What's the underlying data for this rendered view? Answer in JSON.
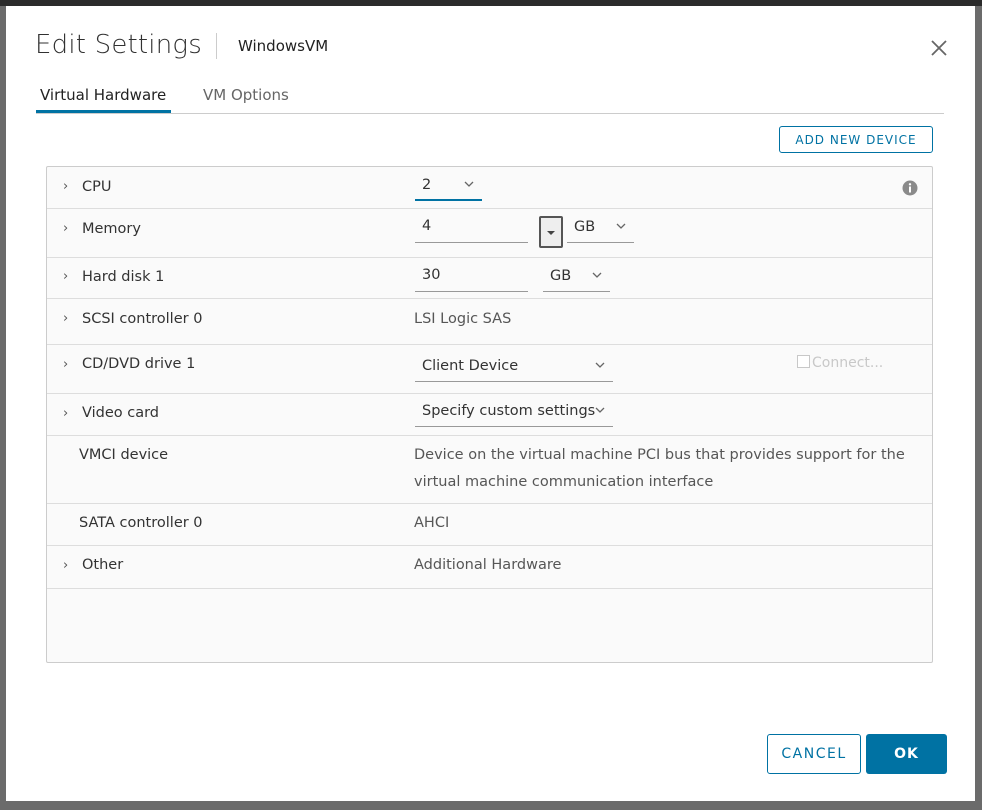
{
  "dialog": {
    "title": "Edit Settings",
    "vm_name": "WindowsVM"
  },
  "tabs": [
    {
      "label": "Virtual Hardware",
      "active": true
    },
    {
      "label": "VM Options",
      "active": false
    }
  ],
  "toolbar": {
    "add_device_label": "ADD NEW DEVICE"
  },
  "hardware": {
    "cpu": {
      "label": "CPU",
      "value": "2"
    },
    "memory": {
      "label": "Memory",
      "value": "4",
      "unit": "GB"
    },
    "hard_disk": {
      "label": "Hard disk 1",
      "value": "30",
      "unit": "GB"
    },
    "scsi": {
      "label": "SCSI controller 0",
      "value": "LSI Logic SAS"
    },
    "cd_dvd": {
      "label": "CD/DVD drive 1",
      "value": "Client Device",
      "connect_label": "Connect..."
    },
    "video": {
      "label": "Video card",
      "value": "Specify custom settings"
    },
    "vmci": {
      "label": "VMCI device",
      "desc_line1": "Device on the virtual machine PCI bus that provides support for the",
      "desc_line2": "virtual machine communication interface"
    },
    "sata": {
      "label": "SATA controller 0",
      "value": "AHCI"
    },
    "other": {
      "label": "Other",
      "value": "Additional Hardware"
    }
  },
  "footer": {
    "cancel_label": "CANCEL",
    "ok_label": "OK"
  },
  "colors": {
    "accent": "#0072a3"
  }
}
